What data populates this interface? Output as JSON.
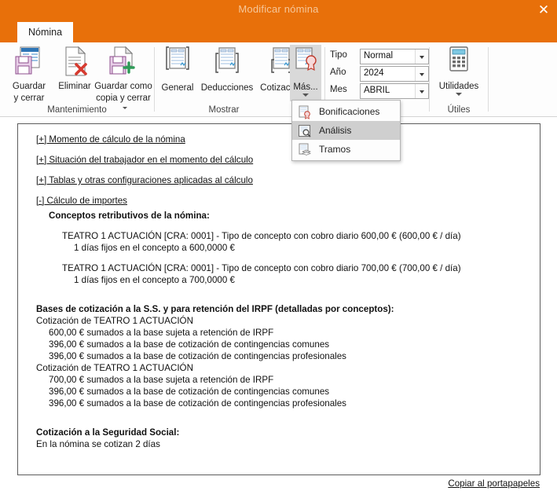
{
  "window": {
    "title": "Modificar nómina",
    "close_label": "✕"
  },
  "ribbon": {
    "tab_label": "Nómina",
    "groups": [
      {
        "name": "mantenimiento",
        "label": "Mantenimiento",
        "buttons": [
          {
            "name": "guardar-y-cerrar",
            "line1": "Guardar",
            "line2": "y cerrar",
            "icon": "save-close-icon"
          },
          {
            "name": "eliminar",
            "line1": "Eliminar",
            "line2": "",
            "icon": "delete-icon"
          },
          {
            "name": "guardar-como-copia-y-cerrar",
            "line1": "Guardar como",
            "line2": "copia y cerrar",
            "icon": "save-copy-icon"
          }
        ]
      },
      {
        "name": "mostrar",
        "label": "Mostrar",
        "buttons": [
          {
            "name": "general",
            "line1": "General",
            "line2": "",
            "icon": "document-general-icon"
          },
          {
            "name": "deducciones",
            "line1": "Deducciones",
            "line2": "",
            "icon": "document-deductions-icon"
          },
          {
            "name": "cotizacion",
            "line1": "Cotización",
            "line2": "",
            "icon": "document-quote-icon"
          },
          {
            "name": "mas",
            "line1": "Más...",
            "line2": "",
            "icon": "document-seal-icon"
          }
        ]
      },
      {
        "name": "identificacion",
        "label": "ación",
        "fields": [
          {
            "name": "tipo",
            "label": "Tipo",
            "value": "Normal"
          },
          {
            "name": "ano",
            "label": "Año",
            "value": "2024"
          },
          {
            "name": "mes",
            "label": "Mes",
            "value": "ABRIL"
          }
        ]
      },
      {
        "name": "utiles",
        "label": "Útiles",
        "buttons": [
          {
            "name": "utilidades",
            "line1": "Utilidades",
            "line2": "",
            "icon": "calculator-icon"
          }
        ]
      }
    ]
  },
  "menu": {
    "items": [
      {
        "name": "bonificaciones",
        "label": "Bonificaciones",
        "icon": "document-seal-icon",
        "highlighted": false
      },
      {
        "name": "analisis",
        "label": "Análisis",
        "icon": "document-search-icon",
        "highlighted": true
      },
      {
        "name": "tramos",
        "label": "Tramos",
        "icon": "document-layers-icon",
        "highlighted": false
      }
    ]
  },
  "content": {
    "toggles": [
      {
        "name": "momento-de-calculo",
        "label": "[+] Momento de cálculo de la nómina"
      },
      {
        "name": "situacion-trabajador",
        "label": "[+] Situación del trabajador en el momento del cálculo"
      },
      {
        "name": "tablas-y-configuraciones",
        "label": "[+] Tablas y otras configuraciones aplicadas al cálculo"
      },
      {
        "name": "calculo-de-importes",
        "label": "[-] Cálculo de importes"
      }
    ],
    "section_conceptos_title": "Conceptos retributivos de la nómina:",
    "concepts": [
      {
        "header": "TEATRO 1 ACTUACIÓN [CRA: 0001] - Tipo de concepto con cobro diario 600,00 € (600,00 € / día)",
        "detail": "1 días fijos en el concepto a 600,0000 €"
      },
      {
        "header": "TEATRO 1 ACTUACIÓN [CRA: 0001] - Tipo de concepto con cobro diario 700,00 € (700,00 € / día)",
        "detail": "1 días fijos en el concepto a 700,0000 €"
      }
    ],
    "bases_title": "Bases de cotización a la S.S. y para retención del IRPF (detalladas por conceptos):",
    "bases_blocks": [
      {
        "header": "Cotización de TEATRO 1 ACTUACIÓN",
        "lines": [
          "600,00 € sumados a la base sujeta a retención de IRPF",
          "396,00 € sumados a la base de cotización de contingencias comunes",
          "396,00 € sumados a la base de cotización de contingencias profesionales"
        ]
      },
      {
        "header": "Cotización de TEATRO 1 ACTUACIÓN",
        "lines": [
          "700,00 € sumados a la base sujeta a retención de IRPF",
          "396,00 € sumados a la base de cotización de contingencias comunes",
          "396,00 € sumados a la base de cotización de contingencias profesionales"
        ]
      }
    ],
    "ss_title": "Cotización a la Seguridad Social:",
    "ss_line": "En la nómina se cotizan 2 días"
  },
  "footer": {
    "copy_label": "Copiar al portapapeles"
  },
  "colors": {
    "accent": "#e8700a",
    "title_text": "#f6c79a",
    "menu_highlight": "#cfcfcf",
    "panel_border": "#5c5c5c"
  }
}
